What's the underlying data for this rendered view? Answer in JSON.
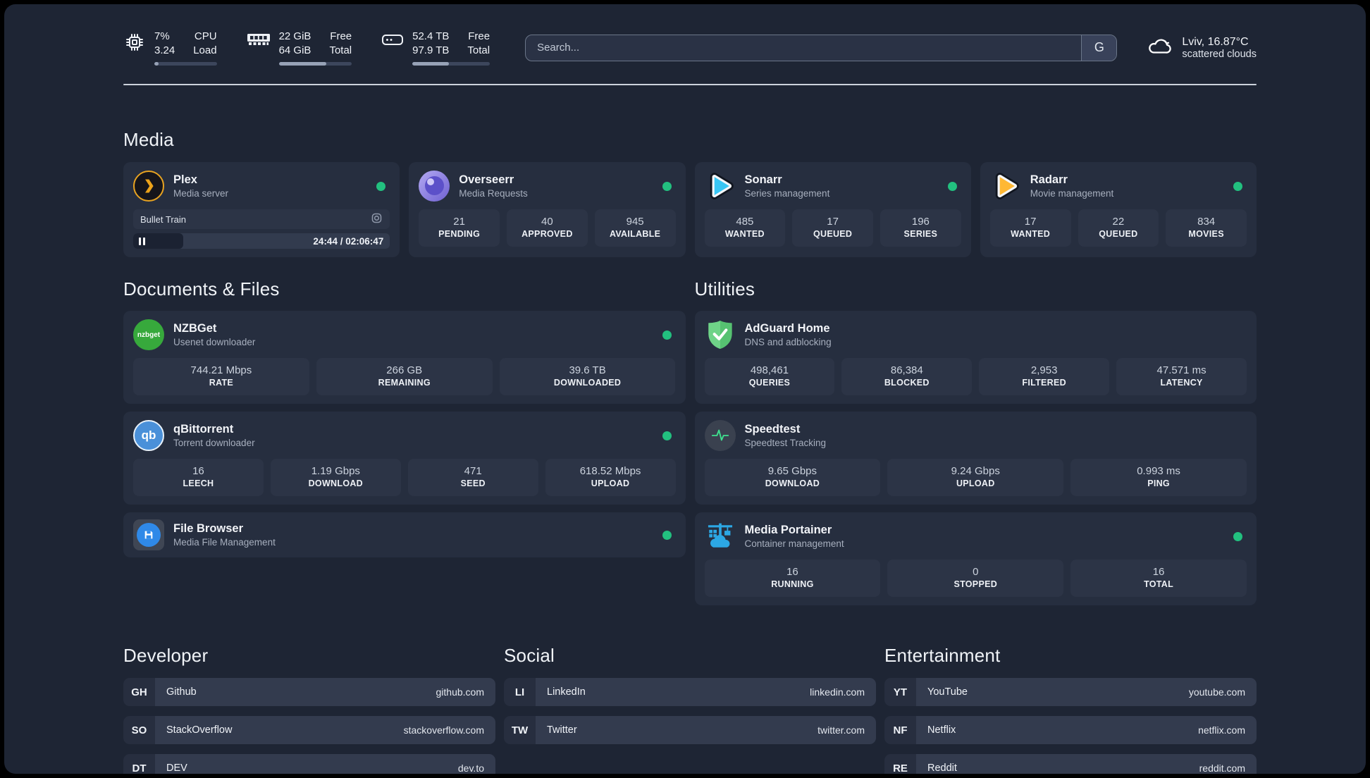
{
  "colors": {
    "background": "#1e2534",
    "card": "#262e3f",
    "stat_box": "#2c3446",
    "status_online": "#22c07f",
    "accent_gold": "#e8a321",
    "accent_cyan": "#38c6f4",
    "accent_blue": "#2ca7e4",
    "accent_green": "#5fc876"
  },
  "topbar": {
    "cpu": {
      "icon": "cpu-chip-icon",
      "line1": "7%",
      "line2": "3.24",
      "label1": "CPU",
      "label2": "Load",
      "progress_pct": 7
    },
    "memory": {
      "icon": "ram-icon",
      "line1": "22 GiB",
      "line2": "64 GiB",
      "label1": "Free",
      "label2": "Total",
      "progress_pct": 65
    },
    "storage": {
      "icon": "disk-icon",
      "line1": "52.4 TB",
      "line2": "97.9 TB",
      "label1": "Free",
      "label2": "Total",
      "progress_pct": 47
    },
    "search": {
      "placeholder": "Search...",
      "engine_button": "G"
    },
    "weather": {
      "icon": "cloud-icon",
      "location": "Lviv, 16.87°C",
      "condition": "scattered clouds"
    }
  },
  "sections": {
    "media": {
      "title": "Media"
    },
    "documents": {
      "title": "Documents & Files"
    },
    "utilities": {
      "title": "Utilities"
    },
    "developer": {
      "title": "Developer"
    },
    "social": {
      "title": "Social"
    },
    "entertainment": {
      "title": "Entertainment"
    }
  },
  "apps": {
    "plex": {
      "name": "Plex",
      "description": "Media server",
      "icon": "plex-icon",
      "online": true,
      "player": {
        "title": "Bullet Train",
        "state": "paused",
        "elapsed": "24:44",
        "duration": "02:06:47",
        "time_display": "24:44 / 02:06:47",
        "progress_pct": 19.5
      }
    },
    "overseerr": {
      "name": "Overseerr",
      "description": "Media Requests",
      "icon": "overseerr-icon",
      "online": true,
      "stats": [
        {
          "value": "21",
          "label": "PENDING"
        },
        {
          "value": "40",
          "label": "APPROVED"
        },
        {
          "value": "945",
          "label": "AVAILABLE"
        }
      ]
    },
    "sonarr": {
      "name": "Sonarr",
      "description": "Series management",
      "icon": "sonarr-icon",
      "online": true,
      "stats": [
        {
          "value": "485",
          "label": "WANTED"
        },
        {
          "value": "17",
          "label": "QUEUED"
        },
        {
          "value": "196",
          "label": "SERIES"
        }
      ]
    },
    "radarr": {
      "name": "Radarr",
      "description": "Movie management",
      "icon": "radarr-icon",
      "online": true,
      "stats": [
        {
          "value": "17",
          "label": "WANTED"
        },
        {
          "value": "22",
          "label": "QUEUED"
        },
        {
          "value": "834",
          "label": "MOVIES"
        }
      ]
    },
    "nzbget": {
      "name": "NZBGet",
      "description": "Usenet downloader",
      "icon": "nzbget-icon",
      "icon_text": "nzbget",
      "online": true,
      "stats": [
        {
          "value": "744.21 Mbps",
          "label": "RATE"
        },
        {
          "value": "266 GB",
          "label": "REMAINING"
        },
        {
          "value": "39.6 TB",
          "label": "DOWNLOADED"
        }
      ]
    },
    "qbittorrent": {
      "name": "qBittorrent",
      "description": "Torrent downloader",
      "icon": "qbittorrent-icon",
      "icon_text": "qb",
      "online": true,
      "stats": [
        {
          "value": "16",
          "label": "LEECH"
        },
        {
          "value": "1.19 Gbps",
          "label": "DOWNLOAD"
        },
        {
          "value": "471",
          "label": "SEED"
        },
        {
          "value": "618.52 Mbps",
          "label": "UPLOAD"
        }
      ]
    },
    "filebrowser": {
      "name": "File Browser",
      "description": "Media File Management",
      "icon": "filebrowser-icon",
      "online": true
    },
    "adguard": {
      "name": "AdGuard Home",
      "description": "DNS and adblocking",
      "icon": "adguard-shield-icon",
      "stats": [
        {
          "value": "498,461",
          "label": "QUERIES"
        },
        {
          "value": "86,384",
          "label": "BLOCKED"
        },
        {
          "value": "2,953",
          "label": "FILTERED"
        },
        {
          "value": "47.571 ms",
          "label": "LATENCY"
        }
      ]
    },
    "speedtest": {
      "name": "Speedtest",
      "description": "Speedtest Tracking",
      "icon": "speedtest-pulse-icon",
      "stats": [
        {
          "value": "9.65 Gbps",
          "label": "DOWNLOAD"
        },
        {
          "value": "9.24 Gbps",
          "label": "UPLOAD"
        },
        {
          "value": "0.993 ms",
          "label": "PING"
        }
      ]
    },
    "portainer": {
      "name": "Media Portainer",
      "description": "Container management",
      "icon": "portainer-crane-icon",
      "online": true,
      "stats": [
        {
          "value": "16",
          "label": "RUNNING"
        },
        {
          "value": "0",
          "label": "STOPPED"
        },
        {
          "value": "16",
          "label": "TOTAL"
        }
      ]
    }
  },
  "links": {
    "developer": [
      {
        "abbr": "GH",
        "name": "Github",
        "url": "github.com"
      },
      {
        "abbr": "SO",
        "name": "StackOverflow",
        "url": "stackoverflow.com"
      },
      {
        "abbr": "DT",
        "name": "DEV",
        "url": "dev.to"
      }
    ],
    "social": [
      {
        "abbr": "LI",
        "name": "LinkedIn",
        "url": "linkedin.com"
      },
      {
        "abbr": "TW",
        "name": "Twitter",
        "url": "twitter.com"
      }
    ],
    "entertainment": [
      {
        "abbr": "YT",
        "name": "YouTube",
        "url": "youtube.com"
      },
      {
        "abbr": "NF",
        "name": "Netflix",
        "url": "netflix.com"
      },
      {
        "abbr": "RE",
        "name": "Reddit",
        "url": "reddit.com"
      }
    ]
  }
}
